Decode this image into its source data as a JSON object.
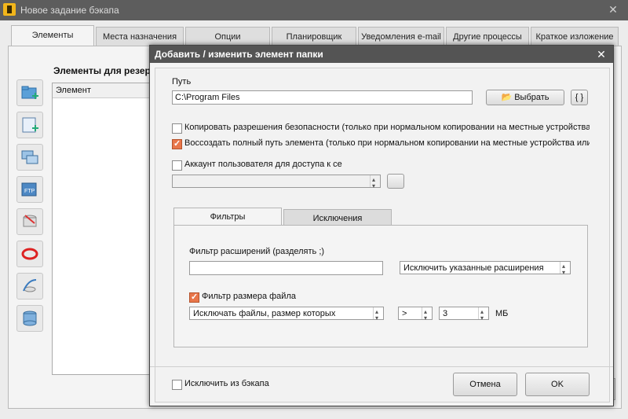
{
  "outer": {
    "title": "Новое задание бэкапа",
    "tabs": [
      "Элементы",
      "Места назначения",
      "Опции",
      "Планировщик",
      "Уведомления e-mail",
      "Другие процессы",
      "Краткое изложение"
    ],
    "elements_title": "Элементы для резер",
    "list_header": "Элемент",
    "side_icons": [
      "add-folder-icon",
      "add-file-icon",
      "network-share-icon",
      "ftp-icon",
      "mssql-icon",
      "oracle-icon",
      "mysql-icon",
      "database-icon"
    ]
  },
  "dialog": {
    "title": "Добавить / изменить элемент папки",
    "path_label": "Путь",
    "path_value": "C:\\Program Files",
    "browse_label": "Выбрать",
    "var_label": "{ }",
    "chk_security": {
      "label": "Копировать разрешения безопасности (только при нормальном копировании на местные устройства или в с",
      "checked": false
    },
    "chk_fullpath": {
      "label": "Воссоздать полный путь элемента (только при нормальном копировании на местные устройства или в сети)",
      "checked": true
    },
    "chk_account": {
      "label": "Аккаунт пользователя для доступа к се",
      "checked": false
    },
    "account_value": "",
    "tabs": [
      "Фильтры",
      "Исключения"
    ],
    "ext_filter_label": "Фильтр расширений (разделять ;)",
    "ext_filter_value": "",
    "ext_mode": "Исключить указанные расширения",
    "chk_size": {
      "label": "Фильтр размера файла",
      "checked": true
    },
    "size_mode": "Исключать файлы, размер которых",
    "size_op": ">",
    "size_value": "3",
    "size_unit": "МБ",
    "chk_exclude": {
      "label": "Исключить из бэкапа",
      "checked": false
    },
    "cancel_label": "Отмена",
    "ok_label": "OK"
  },
  "colors": {
    "check_on": "#e8764a",
    "title_bar": "#545454"
  }
}
